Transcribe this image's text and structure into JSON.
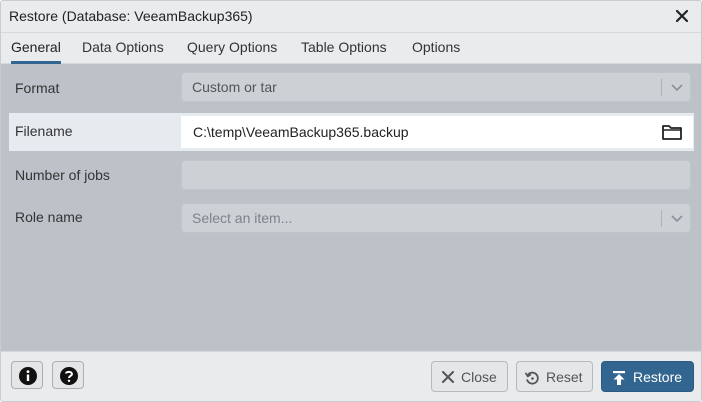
{
  "dialog": {
    "title": "Restore (Database: VeeamBackup365)"
  },
  "tabs": [
    {
      "label": "General",
      "active": true
    },
    {
      "label": "Data Options",
      "active": false
    },
    {
      "label": "Query Options",
      "active": false
    },
    {
      "label": "Table Options",
      "active": false
    },
    {
      "label": "Options",
      "active": false
    }
  ],
  "form": {
    "format": {
      "label": "Format",
      "value": "Custom or tar"
    },
    "filename": {
      "label": "Filename",
      "value": "C:\\temp\\VeeamBackup365.backup"
    },
    "jobs": {
      "label": "Number of jobs",
      "value": ""
    },
    "role": {
      "label": "Role name",
      "placeholder": "Select an item..."
    }
  },
  "footer": {
    "close_label": "Close",
    "reset_label": "Reset",
    "restore_label": "Restore"
  },
  "icons": {
    "close": "close-icon",
    "chevron": "chevron-down-icon",
    "folder": "folder-icon",
    "info": "info-icon",
    "help": "help-icon",
    "reset": "reset-icon",
    "restore": "restore-upload-icon"
  },
  "colors": {
    "accent": "#326690",
    "form_background": "#bcc2c8",
    "highlight_row": "#e6ebf0"
  }
}
